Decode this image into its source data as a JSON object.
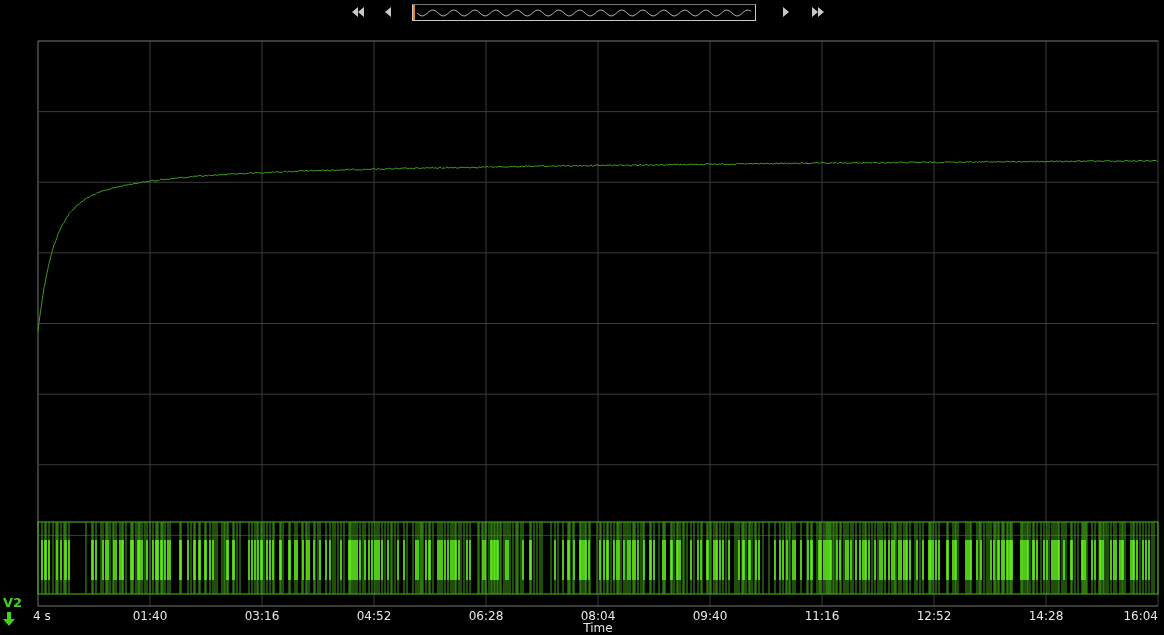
{
  "toolbar": {
    "buttons": [
      {
        "kind": "first"
      },
      {
        "kind": "previous"
      },
      {
        "kind": "overview"
      },
      {
        "kind": "next"
      },
      {
        "kind": "last"
      }
    ]
  },
  "chart": {
    "channel_label": "V2",
    "x_axis_title": "Time",
    "x_tick_labels": [
      "4 s",
      "01:40",
      "03:16",
      "04:52",
      "06:28",
      "08:04",
      "09:40",
      "11:16",
      "12:52",
      "14:28",
      "16:04"
    ]
  }
}
